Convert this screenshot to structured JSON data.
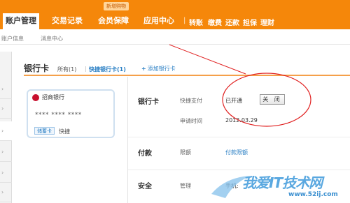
{
  "nav": {
    "tabs": [
      "账户管理",
      "交易记录",
      "会员保障",
      "应用中心"
    ],
    "new_badge": "新增购物",
    "quick_links": [
      "转账",
      "缴费",
      "还款",
      "担保",
      "理财"
    ]
  },
  "subnav": {
    "items": [
      "账户信息",
      "消息中心"
    ]
  },
  "page": {
    "title": "银行卡",
    "filter_all": "所有(1)",
    "filter_sep": "|",
    "filter_quick": "快捷银行卡(1)",
    "add_card": "添加银行卡"
  },
  "card": {
    "bank_name": "招商银行",
    "card_number": "**** **** ****",
    "tag": "储蓄卡",
    "tag2": "快捷"
  },
  "section_bank": {
    "title": "银行卡",
    "quick_pay_label": "快捷支付",
    "quick_pay_status": "已开通",
    "close_button": "关 闭",
    "apply_time_label": "申请时间",
    "apply_time_value": "2012.03.29"
  },
  "section_pay": {
    "title": "付款",
    "limit_label": "限额",
    "limit_link": "付款限额"
  },
  "section_security": {
    "title": "安全",
    "manage_label": "管理",
    "phone_label": "手机:"
  },
  "watermark": {
    "main": "我爱IT技术网",
    "url": "www.52ij.com"
  },
  "colors": {
    "nav_orange": "#f5870a",
    "link_blue": "#2a7fc4",
    "annotation_red": "#e02020"
  }
}
